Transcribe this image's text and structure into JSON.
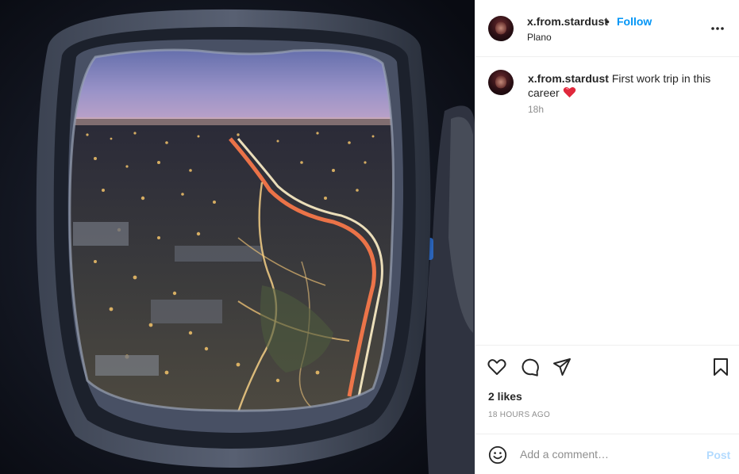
{
  "post": {
    "username": "x.from.stardust",
    "separator": "•",
    "follow_label": "Follow",
    "location": "Plano",
    "more_options_icon": "more-horizontal-icon"
  },
  "caption": {
    "username": "x.from.stardust",
    "text": "First work trip in this career",
    "emoji_icon": "heart-emoji-icon",
    "time": "18h"
  },
  "actions": {
    "like_icon": "heart-icon",
    "comment_icon": "comment-icon",
    "share_icon": "send-icon",
    "save_icon": "bookmark-icon",
    "likes_text": "2 likes",
    "time_ago": "18 HOURS AGO"
  },
  "comment_box": {
    "emoji_icon": "smiley-icon",
    "placeholder": "Add a comment…",
    "post_label": "Post"
  },
  "colors": {
    "accent": "#0095f6",
    "post_disabled": "#b3dbff",
    "muted": "#8e8e8e"
  }
}
